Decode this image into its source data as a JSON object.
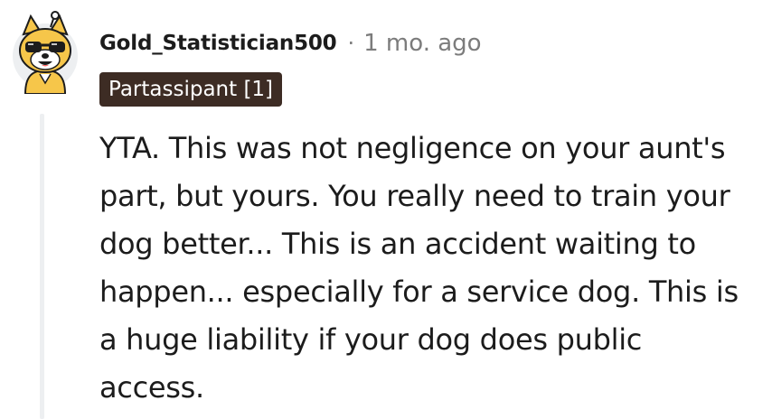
{
  "comment": {
    "username": "Gold_Statistician500",
    "separator": "·",
    "timestamp": "1 mo. ago",
    "flair": "Partassipant [1]",
    "body": "YTA. This was not negligence on your aunt's part, but yours. You really need to train your dog better... This is an accident waiting to happen... especially for a service dog. This is a huge liability if your dog does public access.",
    "avatar_icon": "snoo-dog-sunglasses-avatar"
  },
  "colors": {
    "flair_background": "#3d2c24",
    "avatar_yellow": "#f6c64a",
    "meta_gray": "#7c7c7c",
    "thread_line": "#edeff1"
  }
}
